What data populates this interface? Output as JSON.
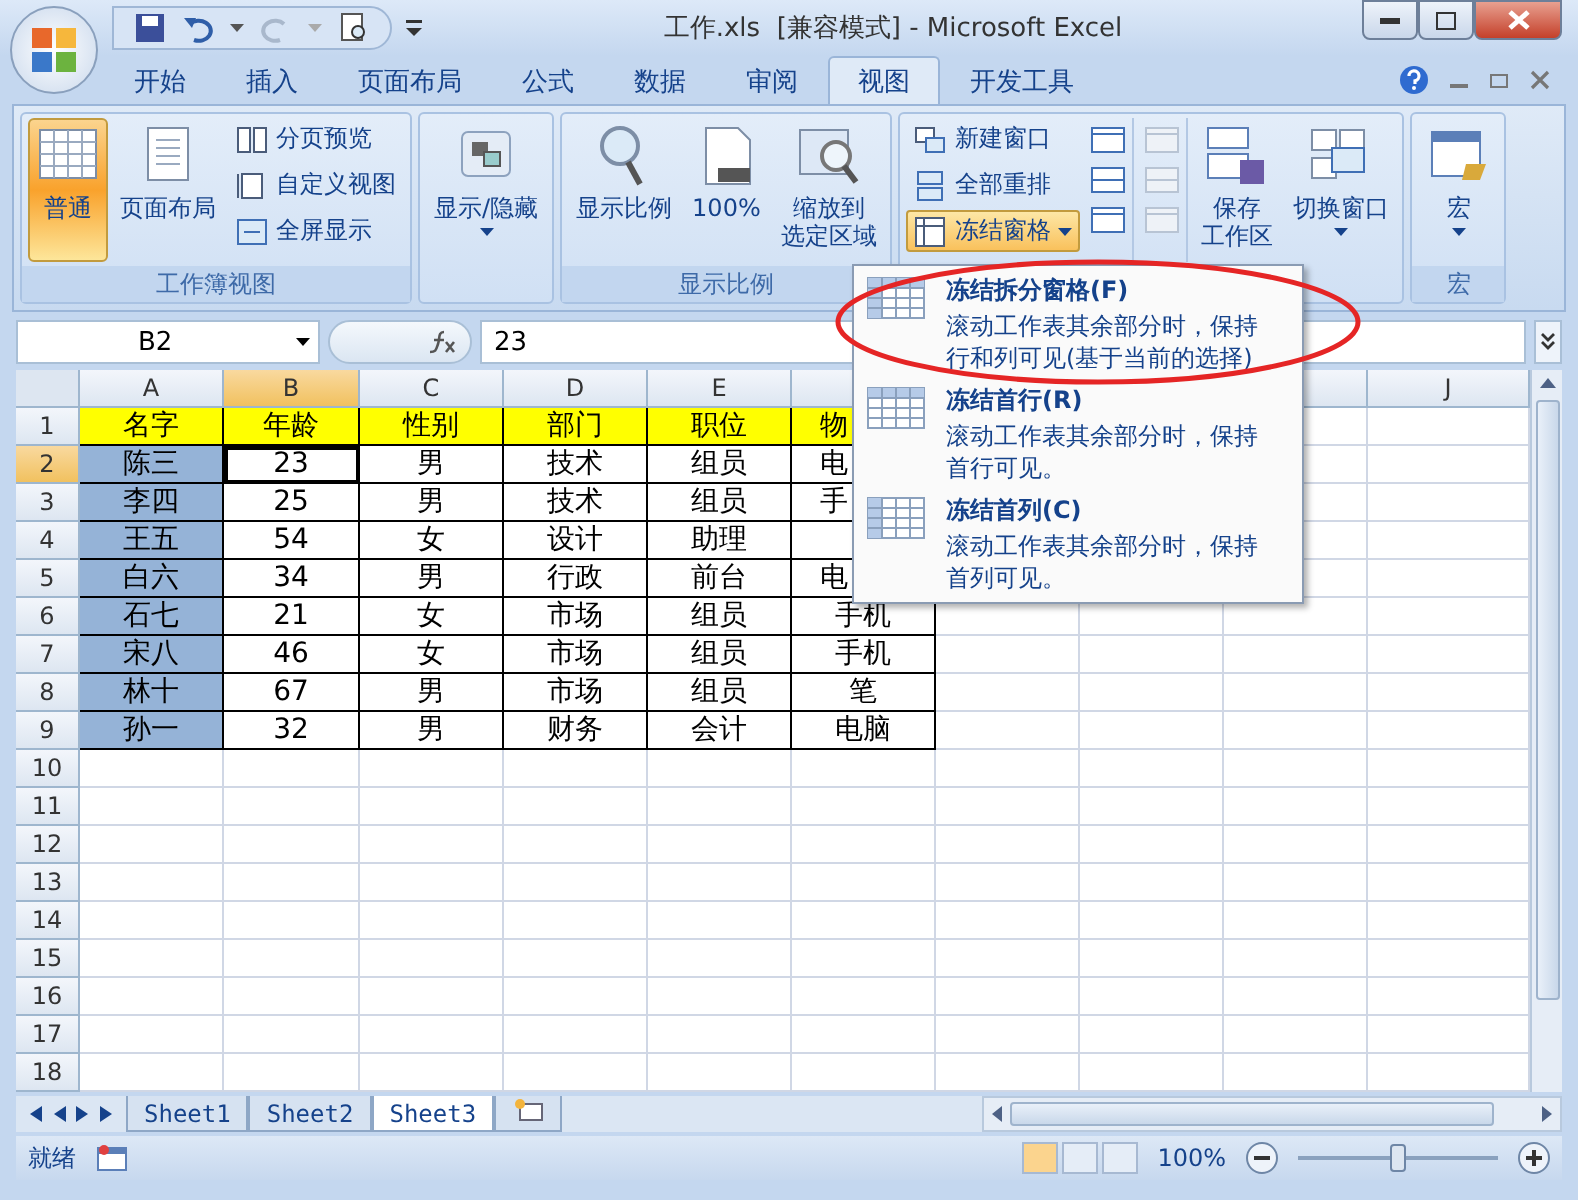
{
  "window": {
    "title": "工作.xls  [兼容模式] - Microsoft Excel"
  },
  "tabs": [
    {
      "label": "开始",
      "selected": false
    },
    {
      "label": "插入",
      "selected": false
    },
    {
      "label": "页面布局",
      "selected": false
    },
    {
      "label": "公式",
      "selected": false
    },
    {
      "label": "数据",
      "selected": false
    },
    {
      "label": "审阅",
      "selected": false
    },
    {
      "label": "视图",
      "selected": true
    },
    {
      "label": "开发工具",
      "selected": false
    }
  ],
  "ribbon_groups": [
    {
      "label": "工作簿视图",
      "items": [
        {
          "kind": "large",
          "lines": [
            "普通"
          ],
          "selected": true,
          "dropdown": false
        },
        {
          "kind": "large",
          "lines": [
            "页面布局"
          ],
          "selected": false,
          "dropdown": false
        },
        {
          "kind": "stack",
          "items": [
            {
              "label": "分页预览",
              "active": false,
              "dropdown": false
            },
            {
              "label": "自定义视图",
              "active": false,
              "dropdown": false
            },
            {
              "label": "全屏显示",
              "active": false,
              "dropdown": false
            }
          ]
        }
      ]
    },
    {
      "items": [
        {
          "kind": "large",
          "lines": [
            "显示/隐藏"
          ],
          "selected": false,
          "dropdown": true
        }
      ]
    },
    {
      "label": "显示比例",
      "items": [
        {
          "kind": "large",
          "lines": [
            "显示比例"
          ],
          "selected": false,
          "dropdown": false
        },
        {
          "kind": "large",
          "lines": [
            "100%"
          ],
          "selected": false,
          "dropdown": false
        },
        {
          "kind": "large",
          "lines": [
            "缩放到",
            "选定区域"
          ],
          "selected": false,
          "dropdown": false
        }
      ]
    },
    {
      "items": [
        {
          "kind": "stack",
          "items": [
            {
              "label": "新建窗口",
              "active": false,
              "dropdown": false
            },
            {
              "label": "全部重排",
              "active": false,
              "dropdown": false
            },
            {
              "label": "冻结窗格",
              "active": true,
              "dropdown": true
            }
          ]
        },
        {
          "kind": "icons",
          "disabled": false
        },
        {
          "kind": "icons",
          "disabled": true
        },
        {
          "kind": "large",
          "lines": [
            "保存",
            "工作区"
          ],
          "selected": false,
          "dropdown": false
        },
        {
          "kind": "large",
          "lines": [
            "切换窗口"
          ],
          "selected": false,
          "dropdown": true
        }
      ]
    },
    {
      "label": "宏",
      "items": [
        {
          "kind": "large",
          "lines": [
            "宏"
          ],
          "selected": false,
          "dropdown": true
        }
      ]
    }
  ],
  "formula_bar": {
    "name_box": "B2",
    "value": "23"
  },
  "sheet": {
    "columns": [
      {
        "label": "A",
        "selected": false,
        "shaded": true
      },
      {
        "label": "B",
        "selected": true,
        "shaded": false
      },
      {
        "label": "C",
        "selected": false,
        "shaded": false
      },
      {
        "label": "D",
        "selected": false,
        "shaded": false
      },
      {
        "label": "E",
        "selected": false,
        "shaded": false
      },
      {
        "label": "J",
        "selected": false,
        "shaded": false
      }
    ],
    "rows": [
      {
        "label": "1",
        "selected": false,
        "header": true,
        "cells": [
          "名字",
          "年龄",
          "性别",
          "部门",
          "职位",
          "物"
        ]
      },
      {
        "label": "2",
        "selected": true,
        "header": false,
        "cells": [
          "陈三",
          "23",
          "男",
          "技术",
          "组员",
          "电"
        ]
      },
      {
        "label": "3",
        "selected": false,
        "header": false,
        "cells": [
          "李四",
          "25",
          "男",
          "技术",
          "组员",
          "手"
        ]
      },
      {
        "label": "4",
        "selected": false,
        "header": false,
        "cells": [
          "王五",
          "54",
          "女",
          "设计",
          "助理"
        ]
      },
      {
        "label": "5",
        "selected": false,
        "header": false,
        "cells": [
          "白六",
          "34",
          "男",
          "行政",
          "前台",
          "电"
        ]
      },
      {
        "label": "6",
        "selected": false,
        "header": false,
        "cells": [
          "石七",
          "21",
          "女",
          "市场",
          "组员",
          "手机"
        ]
      },
      {
        "label": "7",
        "selected": false,
        "header": false,
        "cells": [
          "宋八",
          "46",
          "女",
          "市场",
          "组员",
          "手机"
        ]
      },
      {
        "label": "8",
        "selected": false,
        "header": false,
        "cells": [
          "林十",
          "67",
          "男",
          "市场",
          "组员",
          "笔"
        ]
      },
      {
        "label": "9",
        "selected": false,
        "header": false,
        "cells": [
          "孙一",
          "32",
          "男",
          "财务",
          "会计",
          "电脑"
        ]
      },
      {
        "label": "10",
        "selected": false
      },
      {
        "label": "11",
        "selected": false
      },
      {
        "label": "12",
        "selected": false
      },
      {
        "label": "13",
        "selected": false
      },
      {
        "label": "14",
        "selected": false
      },
      {
        "label": "15",
        "selected": false
      },
      {
        "label": "16",
        "selected": false
      },
      {
        "label": "17",
        "selected": false
      },
      {
        "label": "18",
        "selected": false
      }
    ]
  },
  "freeze_menu": {
    "items": [
      {
        "title": "冻结拆分窗格(F)",
        "description": "滚动工作表其余部分时，保持行和列可见(基于当前的选择)"
      },
      {
        "title": "冻结首行(R)",
        "description": "滚动工作表其余部分时，保持首行可见。"
      },
      {
        "title": "冻结首列(C)",
        "description": "滚动工作表其余部分时，保持首列可见。"
      }
    ]
  },
  "sheet_tabs": [
    {
      "label": "Sheet1",
      "selected": false
    },
    {
      "label": "Sheet2",
      "selected": false
    },
    {
      "label": "Sheet3",
      "selected": true
    }
  ],
  "status_bar": {
    "text": "就绪",
    "zoom": "100%",
    "zoom_slider": {
      "level": 0.5
    }
  }
}
